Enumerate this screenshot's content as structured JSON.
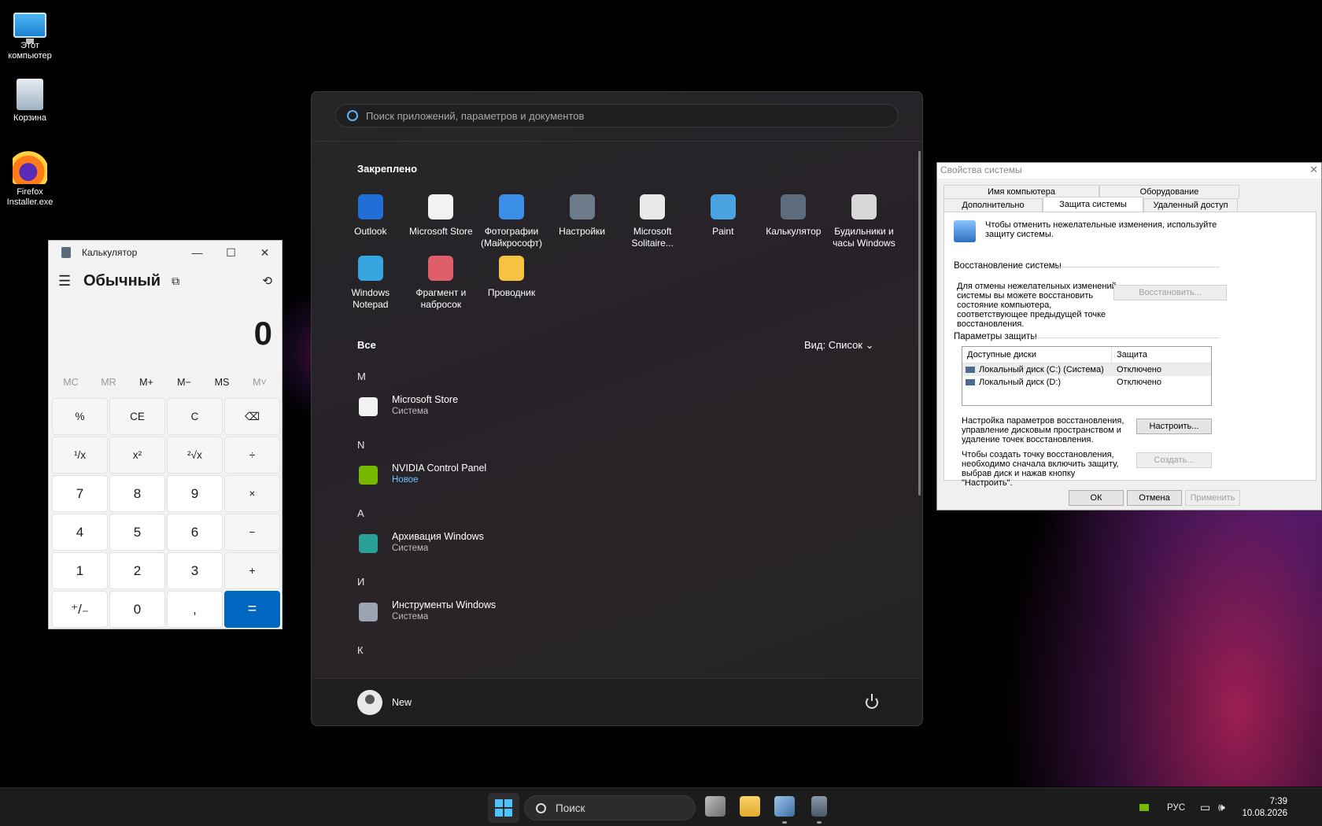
{
  "desktop": {
    "icons": [
      {
        "label_line1": "Этот",
        "label_line2": "компьютер",
        "icon": "this-pc-icon"
      },
      {
        "label_line1": "Корзина",
        "label_line2": "",
        "icon": "recycle-bin-icon"
      },
      {
        "label_line1": "Firefox",
        "label_line2": "Installer.exe",
        "icon": "firefox-installer-icon"
      }
    ]
  },
  "calculator": {
    "title": "Калькулятор",
    "mode": "Обычный",
    "display": "0",
    "memory": [
      "MC",
      "MR",
      "M+",
      "M−",
      "MS",
      "M˅"
    ],
    "keys": [
      {
        "label": "%",
        "type": "fn"
      },
      {
        "label": "CE",
        "type": "fn"
      },
      {
        "label": "C",
        "type": "fn"
      },
      {
        "label": "⌫",
        "type": "fn"
      },
      {
        "label": "¹/x",
        "type": "fn"
      },
      {
        "label": "x²",
        "type": "fn"
      },
      {
        "label": "²√x",
        "type": "fn"
      },
      {
        "label": "÷",
        "type": "fn"
      },
      {
        "label": "7",
        "type": "num"
      },
      {
        "label": "8",
        "type": "num"
      },
      {
        "label": "9",
        "type": "num"
      },
      {
        "label": "×",
        "type": "fn"
      },
      {
        "label": "4",
        "type": "num"
      },
      {
        "label": "5",
        "type": "num"
      },
      {
        "label": "6",
        "type": "num"
      },
      {
        "label": "−",
        "type": "fn"
      },
      {
        "label": "1",
        "type": "num"
      },
      {
        "label": "2",
        "type": "num"
      },
      {
        "label": "3",
        "type": "num"
      },
      {
        "label": "+",
        "type": "fn"
      },
      {
        "label": "⁺/₋",
        "type": "num"
      },
      {
        "label": "0",
        "type": "num"
      },
      {
        "label": ",",
        "type": "num"
      },
      {
        "label": "=",
        "type": "eq"
      }
    ]
  },
  "start_menu": {
    "search_placeholder": "Поиск приложений, параметров и документов",
    "pinned_title": "Закреплено",
    "pinned": [
      {
        "line1": "Outlook",
        "line2": "",
        "icon": "outlook-icon",
        "color": "#1f6fd6"
      },
      {
        "line1": "Microsoft Store",
        "line2": "",
        "icon": "microsoft-store-icon",
        "color": "#f2f2f2"
      },
      {
        "line1": "Фотографии",
        "line2": "(Майкрософт)",
        "icon": "photos-icon",
        "color": "#3a8ee6"
      },
      {
        "line1": "Настройки",
        "line2": "",
        "icon": "settings-icon",
        "color": "#6d7b8a"
      },
      {
        "line1": "Microsoft",
        "line2": "Solitaire...",
        "icon": "solitaire-icon",
        "color": "#e8e8e8"
      },
      {
        "line1": "Paint",
        "line2": "",
        "icon": "paint-icon",
        "color": "#4aa3e0"
      },
      {
        "line1": "Калькулятор",
        "line2": "",
        "icon": "calculator-icon",
        "color": "#5d6d7e"
      },
      {
        "line1": "Будильники и",
        "line2": "часы Windows",
        "icon": "alarms-clock-icon",
        "color": "#d8d8d8"
      },
      {
        "line1": "Windows",
        "line2": "Notepad",
        "icon": "notepad-icon",
        "color": "#35a6e0"
      },
      {
        "line1": "Фрагмент и",
        "line2": "набросок",
        "icon": "snipping-tool-icon",
        "color": "#e05d6a"
      },
      {
        "line1": "Проводник",
        "line2": "",
        "icon": "file-explorer-icon",
        "color": "#f5c242"
      }
    ],
    "all_title": "Все",
    "view_label": "Вид: Список",
    "list": [
      {
        "letter": "M",
        "name": "Microsoft Store",
        "sub": "Система",
        "is_new": false,
        "icon": "microsoft-store-icon",
        "color": "#f2f2f2"
      },
      {
        "letter": "N",
        "name": "NVIDIA Control Panel",
        "sub": "Новое",
        "is_new": true,
        "icon": "nvidia-icon",
        "color": "#76b900"
      },
      {
        "letter": "A",
        "name": "Архивация Windows",
        "sub": "Система",
        "is_new": false,
        "icon": "backup-icon",
        "color": "#2aa198"
      },
      {
        "letter": "И",
        "name": "Инструменты Windows",
        "sub": "Система",
        "is_new": false,
        "icon": "windows-tools-icon",
        "color": "#9aa5b1"
      }
    ],
    "next_letter": "К",
    "user_name": "New"
  },
  "system_properties": {
    "title": "Свойства системы",
    "tabs_row1": [
      "Имя компьютера",
      "Оборудование"
    ],
    "tabs_row2": [
      "Дополнительно",
      "Защита системы",
      "Удаленный доступ"
    ],
    "intro": "Чтобы отменить нежелательные изменения, используйте защиту системы.",
    "restore_section": "Восстановление системы",
    "restore_text": "Для отмены нежелательных изменений системы вы можете восстановить состояние компьютера, соответствующее предыдущей точке восстановления.",
    "restore_button": "Восстановить...",
    "protection_section": "Параметры защиты",
    "table_headers": [
      "Доступные диски",
      "Защита"
    ],
    "drives": [
      {
        "name": "Локальный диск (C:) (Система)",
        "status": "Отключено"
      },
      {
        "name": "Локальный диск (D:)",
        "status": "Отключено"
      }
    ],
    "configure_text": "Настройка параметров восстановления, управление дисковым пространством и удаление точек восстановления.",
    "configure_button": "Настроить...",
    "create_text": "Чтобы создать точку восстановления, необходимо сначала включить защиту, выбрав диск и нажав кнопку \"Настроить\".",
    "create_button": "Создать...",
    "ok": "ОК",
    "cancel": "Отмена",
    "apply": "Применить"
  },
  "taskbar": {
    "search_label": "Поиск",
    "language": "РУС",
    "time": "7:39",
    "date": "10.08.2026"
  }
}
